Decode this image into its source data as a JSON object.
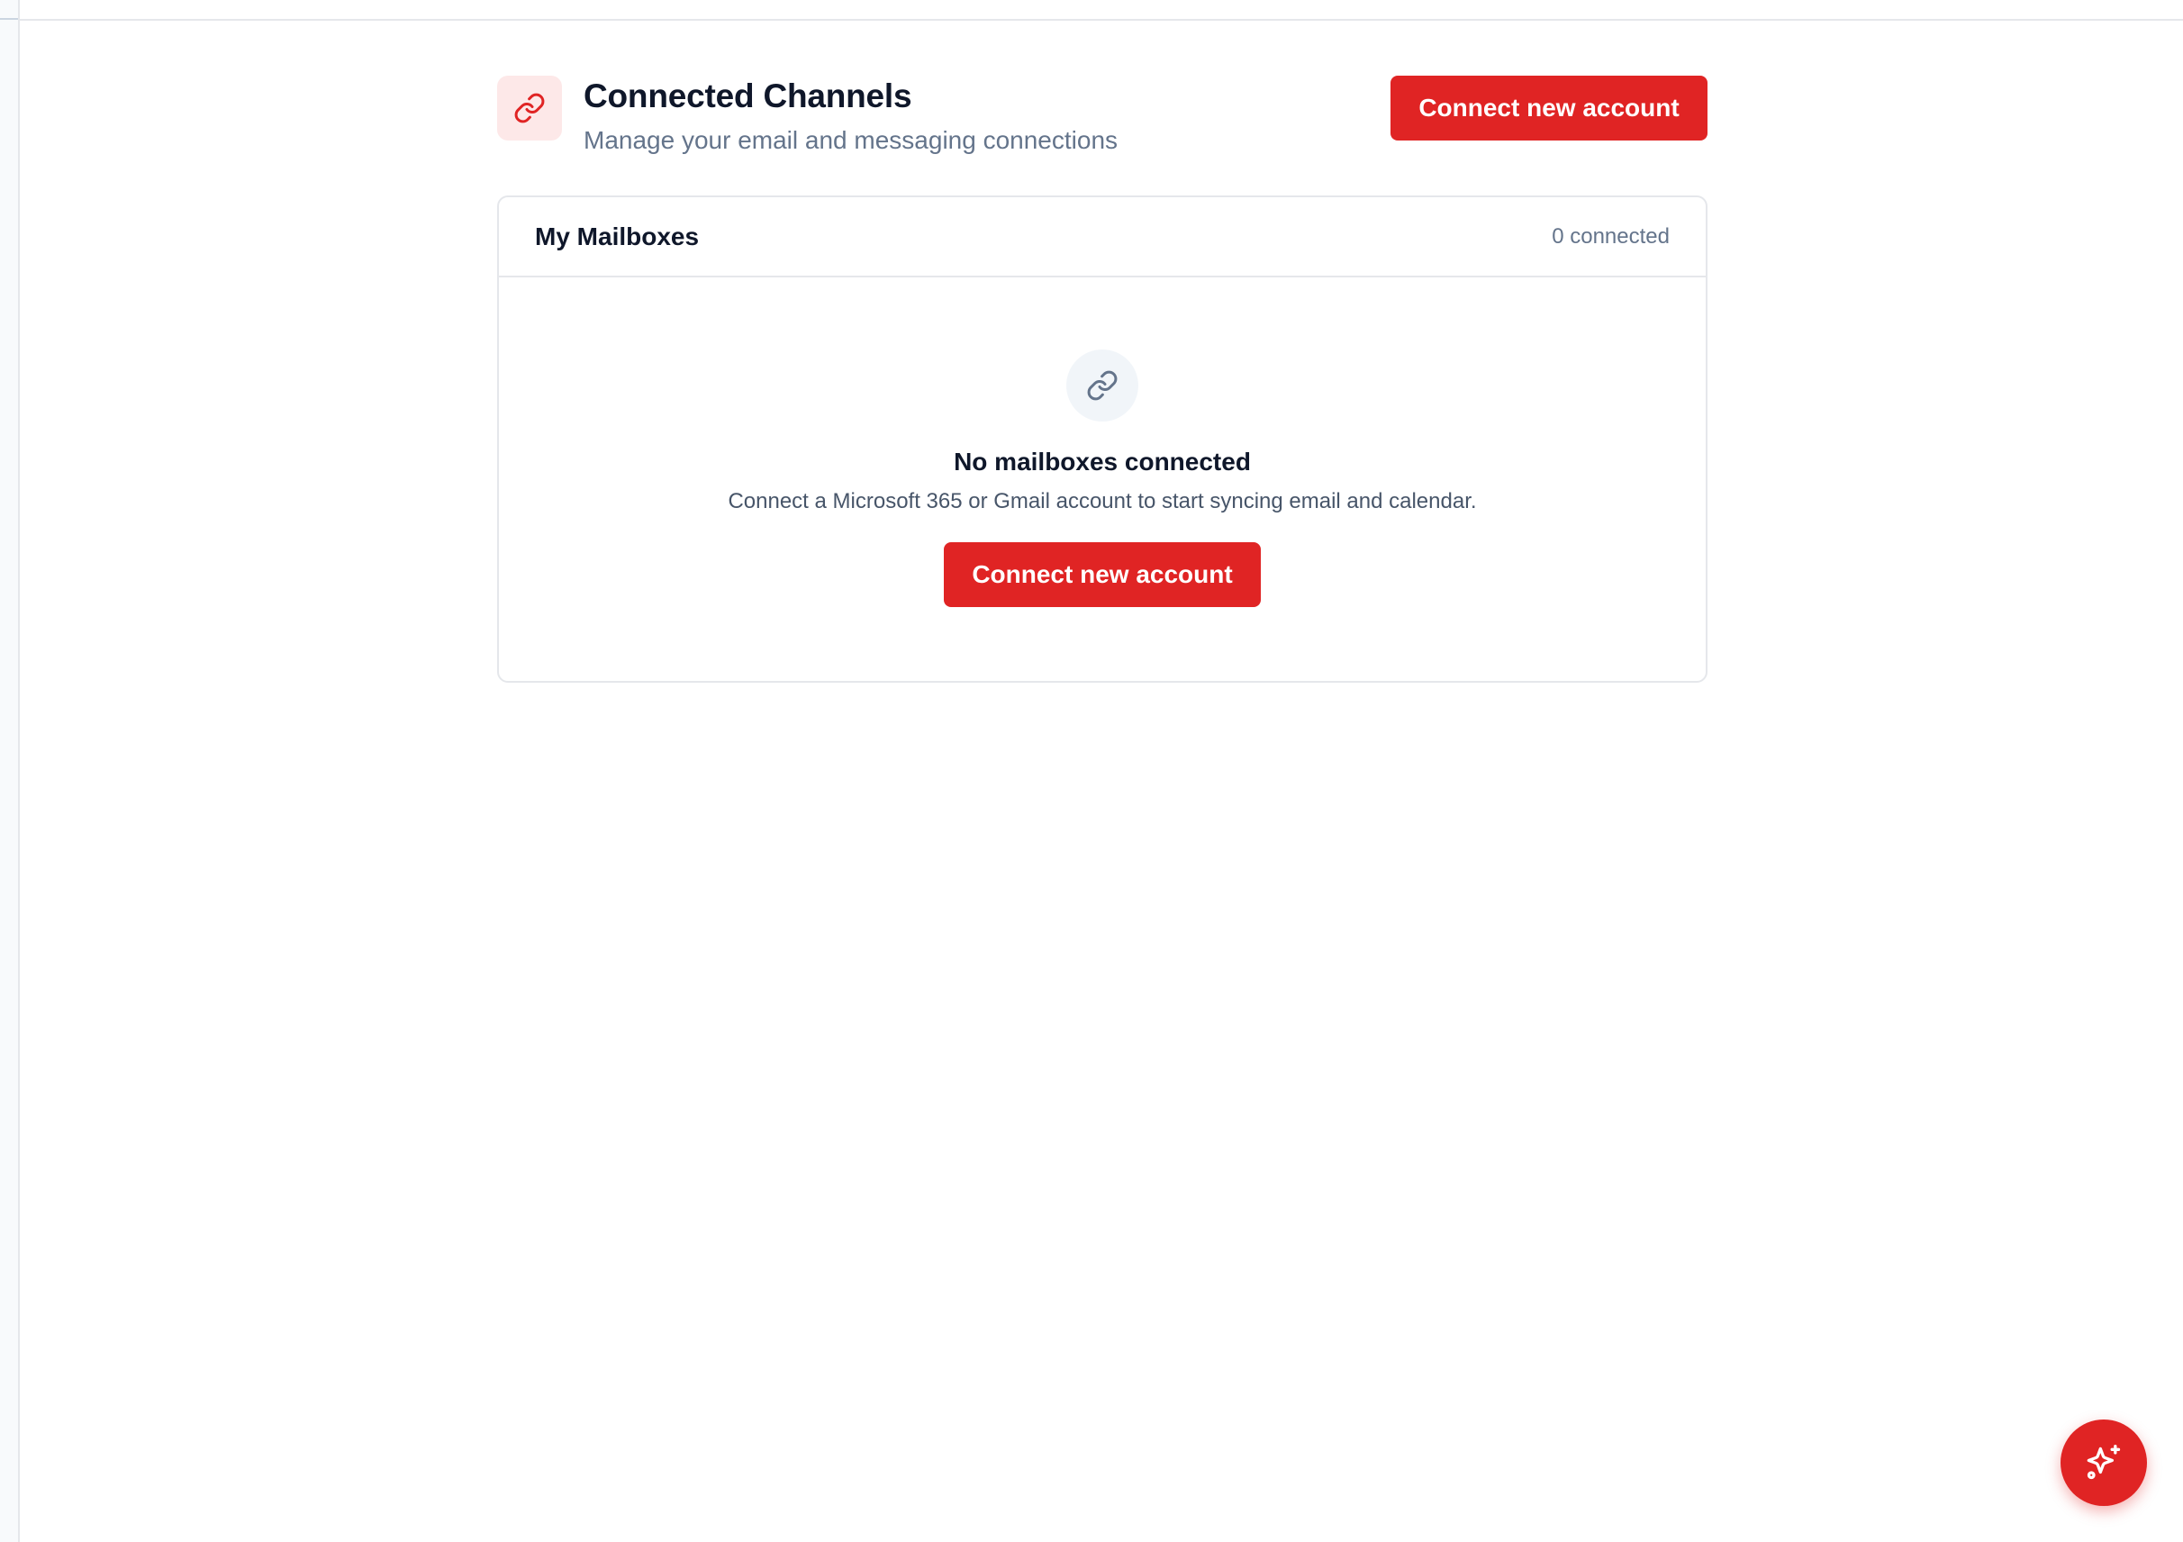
{
  "header": {
    "title": "Connected Channels",
    "subtitle": "Manage your email and messaging connections",
    "connect_button": "Connect new account",
    "icon": "link-icon"
  },
  "mailboxes": {
    "title": "My Mailboxes",
    "count_label": "0 connected",
    "empty_icon": "link-icon",
    "empty_title": "No mailboxes connected",
    "empty_description": "Connect a Microsoft 365 or Gmail account to start syncing email and calendar.",
    "connect_button": "Connect new account"
  },
  "fab": {
    "icon": "sparkles-icon"
  },
  "colors": {
    "accent": "#e02424",
    "accent_soft": "#fde8e8",
    "muted_text": "#64748b",
    "border": "#e5e7eb"
  }
}
